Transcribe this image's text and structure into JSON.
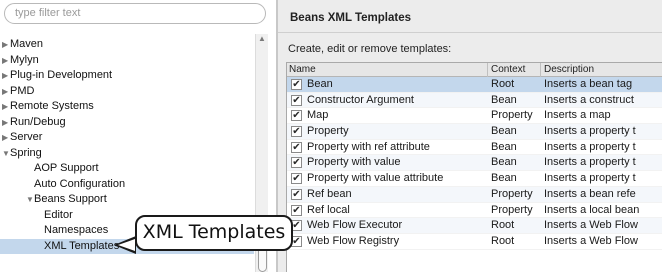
{
  "filter": {
    "placeholder": "type filter text"
  },
  "tree": [
    {
      "label": "Maven",
      "toggle": "▶",
      "indent": 0,
      "selected": false
    },
    {
      "label": "Mylyn",
      "toggle": "▶",
      "indent": 0,
      "selected": false
    },
    {
      "label": "Plug-in Development",
      "toggle": "▶",
      "indent": 0,
      "selected": false
    },
    {
      "label": "PMD",
      "toggle": "▶",
      "indent": 0,
      "selected": false
    },
    {
      "label": "Remote Systems",
      "toggle": "▶",
      "indent": 0,
      "selected": false
    },
    {
      "label": "Run/Debug",
      "toggle": "▶",
      "indent": 0,
      "selected": false
    },
    {
      "label": "Server",
      "toggle": "▶",
      "indent": 0,
      "selected": false
    },
    {
      "label": "Spring",
      "toggle": "▼",
      "indent": 0,
      "selected": false
    },
    {
      "label": "AOP Support",
      "toggle": "",
      "indent": 1,
      "selected": false
    },
    {
      "label": "Auto Configuration",
      "toggle": "",
      "indent": 1,
      "selected": false
    },
    {
      "label": "Beans Support",
      "toggle": "▼",
      "indent": 1,
      "selected": false
    },
    {
      "label": "Editor",
      "toggle": "",
      "indent": 2,
      "selected": false
    },
    {
      "label": "Namespaces",
      "toggle": "",
      "indent": 2,
      "selected": false
    },
    {
      "label": "XML Templates",
      "toggle": "",
      "indent": 2,
      "selected": true
    }
  ],
  "page": {
    "title": "Beans XML Templates",
    "instructions": "Create, edit or remove templates:"
  },
  "table": {
    "columns": [
      "Name",
      "Context",
      "Description"
    ],
    "rows": [
      {
        "checked": true,
        "name": "Bean",
        "context": "Root",
        "description": "Inserts a bean tag"
      },
      {
        "checked": true,
        "name": "Constructor Argument",
        "context": "Bean",
        "description": "Inserts a construct"
      },
      {
        "checked": true,
        "name": "Map",
        "context": "Property",
        "description": "Inserts a map"
      },
      {
        "checked": true,
        "name": "Property",
        "context": "Bean",
        "description": "Inserts a property t"
      },
      {
        "checked": true,
        "name": "Property with ref attribute",
        "context": "Bean",
        "description": "Inserts a property t"
      },
      {
        "checked": true,
        "name": "Property with value",
        "context": "Bean",
        "description": "Inserts a property t"
      },
      {
        "checked": true,
        "name": "Property with value attribute",
        "context": "Bean",
        "description": "Inserts a property t"
      },
      {
        "checked": true,
        "name": "Ref bean",
        "context": "Property",
        "description": "Inserts a bean refe"
      },
      {
        "checked": true,
        "name": "Ref local",
        "context": "Property",
        "description": "Inserts a local bean"
      },
      {
        "checked": true,
        "name": "Web Flow Executor",
        "context": "Root",
        "description": "Inserts a Web Flow"
      },
      {
        "checked": true,
        "name": "Web Flow Registry",
        "context": "Root",
        "description": "Inserts a Web Flow"
      }
    ]
  },
  "callout": {
    "text": "XML Templates"
  },
  "icons": {
    "scroll_up": "scroll-up-arrow-icon",
    "checkbox": "checkmark-icon"
  },
  "colors": {
    "selection": "#c3d7ec",
    "panel": "#ececec"
  }
}
